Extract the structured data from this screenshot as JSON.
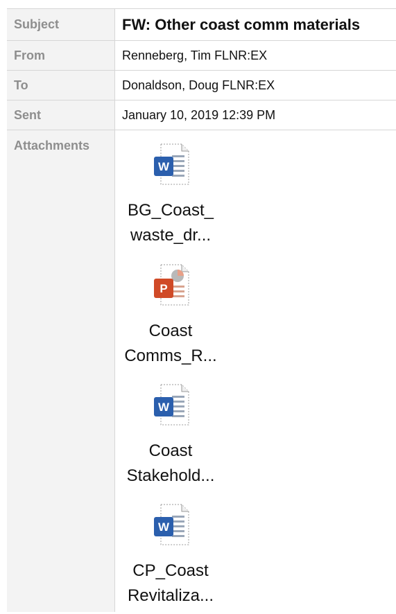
{
  "header": {
    "subject_label": "Subject",
    "subject_value": "FW: Other coast comm materials",
    "from_label": "From",
    "from_value": "Renneberg, Tim FLNR:EX",
    "to_label": "To",
    "to_value": "Donaldson, Doug FLNR:EX",
    "sent_label": "Sent",
    "sent_value": "January 10, 2019 12:39 PM",
    "attachments_label": "Attachments"
  },
  "attachments": [
    {
      "icon": "word-document-icon",
      "line1": "BG_Coast_",
      "line2": "waste_dr..."
    },
    {
      "icon": "powerpoint-document-icon",
      "line1": "Coast",
      "line2": "Comms_R..."
    },
    {
      "icon": "word-document-icon",
      "line1": "Coast",
      "line2": "Stakehold..."
    },
    {
      "icon": "word-document-icon",
      "line1": "CP_Coast",
      "line2": "Revitaliza..."
    }
  ],
  "colors": {
    "label_background": "#f3f3f3",
    "label_text": "#8e8e8e",
    "word_blue": "#2b5fad",
    "powerpoint_orange": "#d04a27"
  }
}
